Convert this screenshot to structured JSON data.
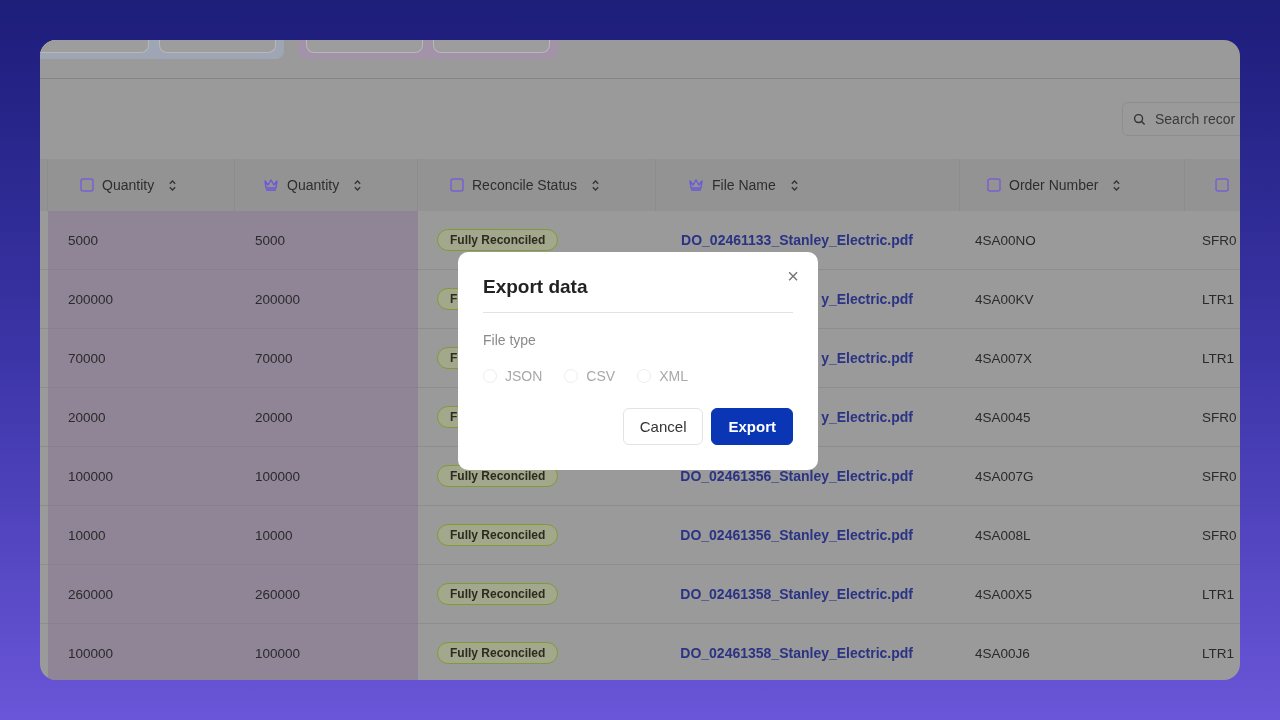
{
  "search": {
    "placeholder": "Search recor"
  },
  "table": {
    "columns": [
      {
        "label": "Quantity",
        "kind": "checkbox"
      },
      {
        "label": "Quantity",
        "kind": "crown"
      },
      {
        "label": "Reconcile Status",
        "kind": "checkbox"
      },
      {
        "label": "File Name",
        "kind": "crown"
      },
      {
        "label": "Order Number",
        "kind": "checkbox"
      },
      {
        "kind": "checkbox"
      }
    ],
    "rows": [
      {
        "quantity": "5000",
        "quantity_2": "5000",
        "reconcile_status": "Fully Reconciled",
        "file_name": "DO_02461133_Stanley_Electric.pdf",
        "order_number": "4SA00NO",
        "column_6": "SFR0"
      },
      {
        "quantity": "200000",
        "quantity_2": "200000",
        "reconcile_status": "F",
        "file_name": "y_Electric.pdf",
        "order_number": "4SA00KV",
        "column_6": "LTR1"
      },
      {
        "quantity": "70000",
        "quantity_2": "70000",
        "reconcile_status": "F",
        "file_name": "y_Electric.pdf",
        "order_number": "4SA007X",
        "column_6": "LTR1"
      },
      {
        "quantity": "20000",
        "quantity_2": "20000",
        "reconcile_status": "F",
        "file_name": "y_Electric.pdf",
        "order_number": "4SA0045",
        "column_6": "SFR0"
      },
      {
        "quantity": "100000",
        "quantity_2": "100000",
        "reconcile_status": "Fully Reconciled",
        "file_name": "DO_02461356_Stanley_Electric.pdf",
        "order_number": "4SA007G",
        "column_6": "SFR0"
      },
      {
        "quantity": "10000",
        "quantity_2": "10000",
        "reconcile_status": "Fully Reconciled",
        "file_name": "DO_02461356_Stanley_Electric.pdf",
        "order_number": "4SA008L",
        "column_6": "SFR0"
      },
      {
        "quantity": "260000",
        "quantity_2": "260000",
        "reconcile_status": "Fully Reconciled",
        "file_name": "DO_02461358_Stanley_Electric.pdf",
        "order_number": "4SA00X5",
        "column_6": "LTR1"
      },
      {
        "quantity": "100000",
        "quantity_2": "100000",
        "reconcile_status": "Fully Reconciled",
        "file_name": "DO_02461358_Stanley_Electric.pdf",
        "order_number": "4SA00J6",
        "column_6": "LTR1"
      }
    ]
  },
  "dialog": {
    "title": "Export data",
    "close": "×",
    "field_label": "File type",
    "options": [
      {
        "label": "JSON",
        "selected": false
      },
      {
        "label": "CSV",
        "selected": false
      },
      {
        "label": "XML",
        "selected": false
      }
    ],
    "buttons": [
      {
        "label": "Cancel",
        "kind": "secondary"
      },
      {
        "label": "Export",
        "kind": "primary"
      }
    ]
  }
}
